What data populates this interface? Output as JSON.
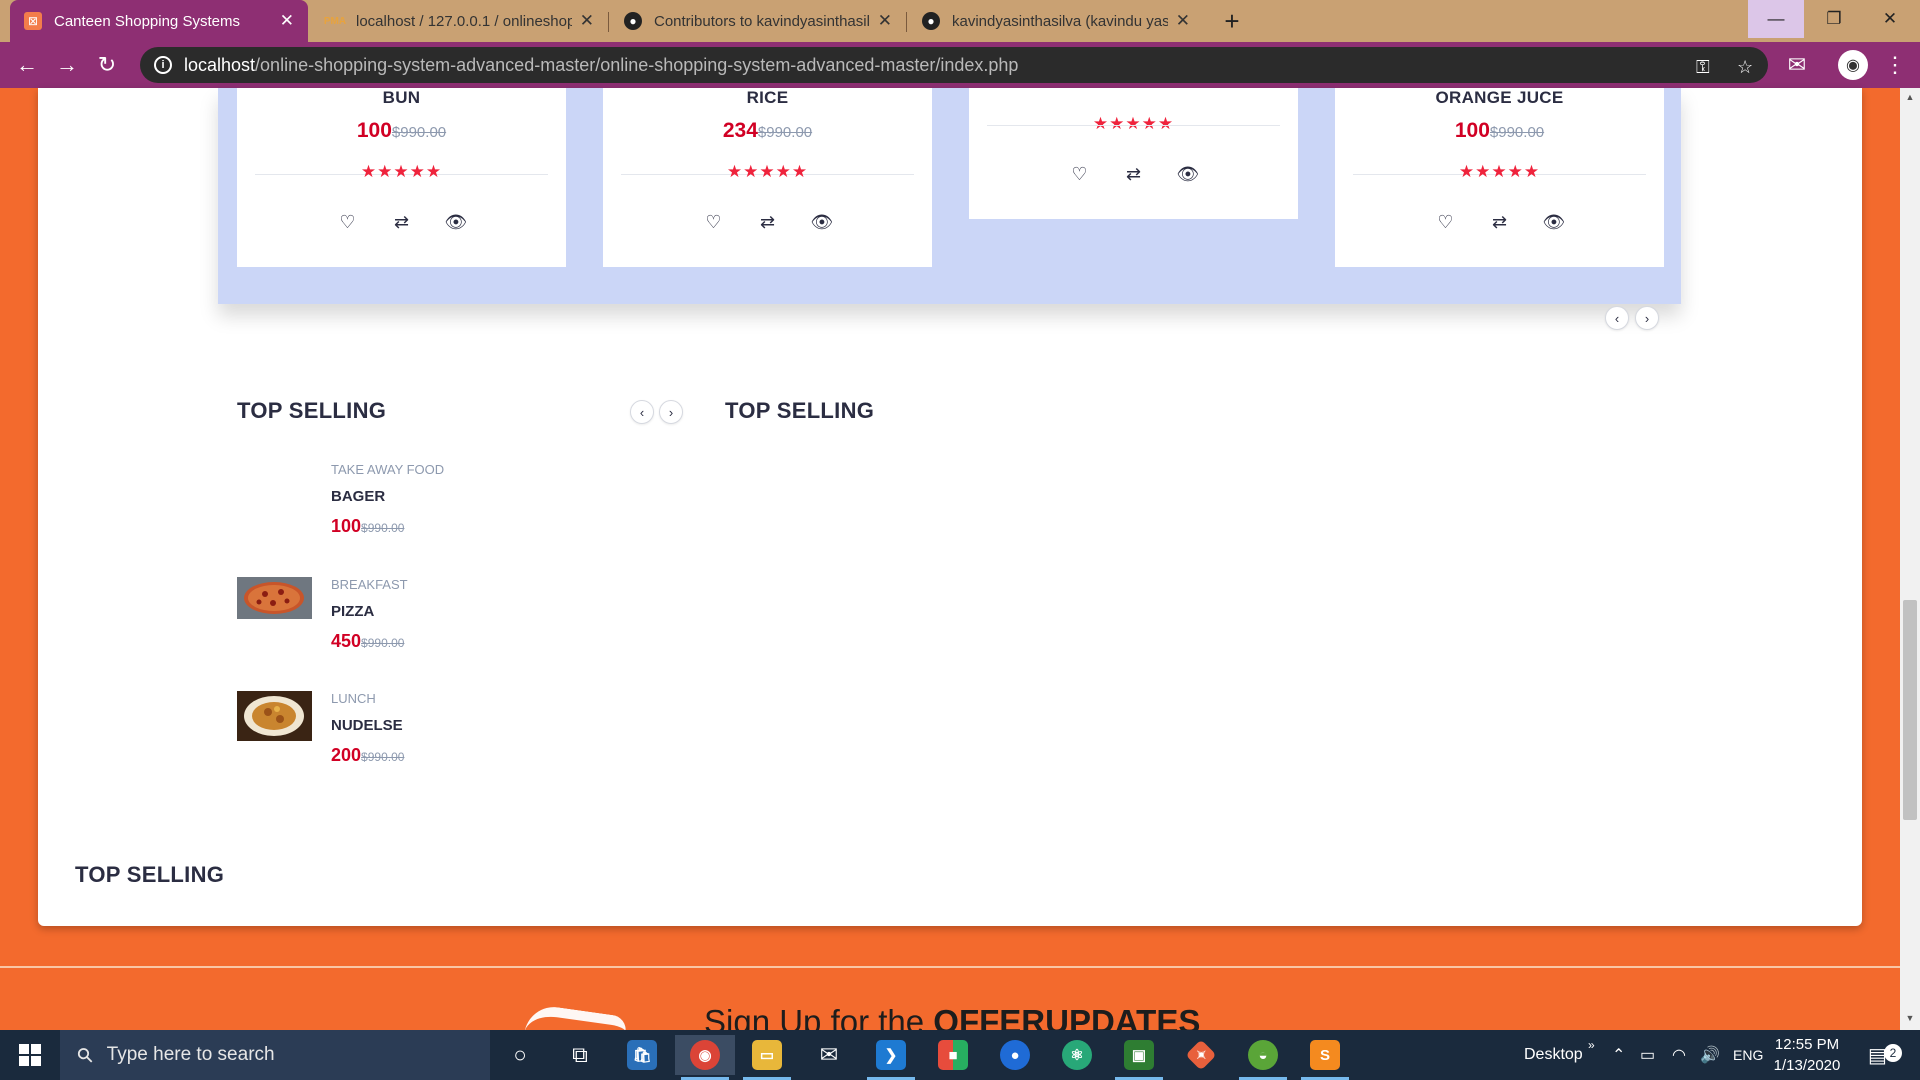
{
  "browser": {
    "tabs": [
      {
        "title": "Canteen Shopping Systems",
        "icon": "store-icon",
        "active": true
      },
      {
        "title": "localhost / 127.0.0.1 / onlineshop",
        "icon": "phpmyadmin-icon",
        "active": false
      },
      {
        "title": "Contributors to kavindyasinthasil",
        "icon": "github-icon",
        "active": false
      },
      {
        "title": "kavindyasinthasilva (kavindu yasi",
        "icon": "github-icon",
        "active": false
      }
    ],
    "new_tab_label": "+",
    "url_host": "localhost",
    "url_path": "/online-shopping-system-advanced-master/online-shopping-system-advanced-master/index.php"
  },
  "products": [
    {
      "name": "BUN",
      "price": "100",
      "old_price": "$990.00",
      "rating": "★★★★★"
    },
    {
      "name": "RICE",
      "price": "234",
      "old_price": "$990.00",
      "rating": "★★★★★"
    },
    {
      "name": "",
      "price": "",
      "old_price": "",
      "rating": "★★★★★"
    },
    {
      "name": "ORANGE JUCE",
      "price": "100",
      "old_price": "$990.00",
      "rating": "★★★★★"
    }
  ],
  "product_actions": {
    "wishlist": "♡",
    "compare": "⇄",
    "quick_view": "👁"
  },
  "sections": {
    "top_selling_1": "TOP SELLING",
    "top_selling_2": "TOP SELLING",
    "top_selling_3": "TOP SELLING"
  },
  "top_selling_items": [
    {
      "category": "TAKE AWAY FOOD",
      "name": "BAGER",
      "price": "100",
      "old_price": "$990.00",
      "image": "none"
    },
    {
      "category": "BREAKFAST",
      "name": "PIZZA",
      "price": "450",
      "old_price": "$990.00",
      "image": "pizza"
    },
    {
      "category": "LUNCH",
      "name": "NUDELSE",
      "price": "200",
      "old_price": "$990.00",
      "image": "noodles"
    }
  ],
  "newsletter": {
    "prefix": "Sign Up for the ",
    "bold": "OFFERUPDATES"
  },
  "taskbar": {
    "search_placeholder": "Type here to search",
    "desktop_label": "Desktop",
    "language": "ENG",
    "time": "12:55 PM",
    "date": "1/13/2020",
    "notification_count": "2"
  },
  "colors": {
    "accent_red": "#d10024",
    "tab_active": "#8e2f73",
    "page_background": "#f36a2d",
    "strip_background": "#cbd6f7"
  }
}
